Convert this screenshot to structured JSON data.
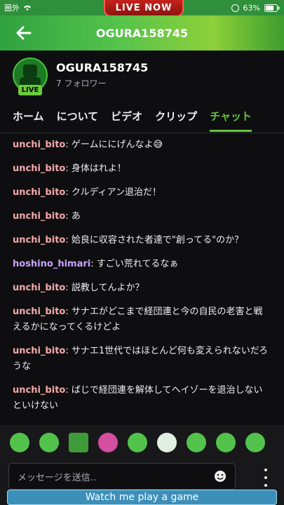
{
  "status_bar": {
    "carrier": "圏外",
    "battery": "63%"
  },
  "live_banner": "LIVE NOW",
  "header": {
    "title": "OGURA158745"
  },
  "profile": {
    "name": "OGURA158745",
    "followers": "7 フォロワー",
    "live_badge": "LIVE"
  },
  "tabs": [
    "ホーム",
    "について",
    "ビデオ",
    "クリップ",
    "チャット"
  ],
  "active_tab": "チャット",
  "chat": [
    {
      "user": "unchi_bito",
      "text": ": ゲームににげんなよ😅",
      "color": "#f4a9a9"
    },
    {
      "user": "unchi_bito",
      "text": ": 身体はれよ！",
      "color": "#f4a9a9"
    },
    {
      "user": "unchi_bito",
      "text": ": クルディアン退治だ！",
      "color": "#f4a9a9"
    },
    {
      "user": "unchi_bito",
      "text": ": あ",
      "color": "#f4a9a9"
    },
    {
      "user": "unchi_bito",
      "text": ": 姶良に収容された者達で\"創ってる\"のか？",
      "color": "#f4a9a9"
    },
    {
      "user": "hoshino_himari",
      "text": ": すごい荒れてるなぁ",
      "color": "#c9a4ff"
    },
    {
      "user": "unchi_bito",
      "text": ": 説教してんよか？",
      "color": "#f4a9a9"
    },
    {
      "user": "unchi_bito",
      "text": ": サナエがどこまで経団連と今の自民の老害と戦えるかになってくるけどよ",
      "color": "#f4a9a9"
    },
    {
      "user": "unchi_bito",
      "text": ": サナエ1世代ではほとんど何も変えられないだろうな",
      "color": "#f4a9a9"
    },
    {
      "user": "unchi_bito",
      "text": ": ばじで経団連を解体してヘイゾーを退治しないといけない",
      "color": "#f4a9a9"
    }
  ],
  "input": {
    "placeholder": "メッセージを送信.."
  },
  "bottom_banner": "Watch me play a game",
  "colors": {
    "accent": "#63c43e",
    "background": "#0e0e10"
  }
}
